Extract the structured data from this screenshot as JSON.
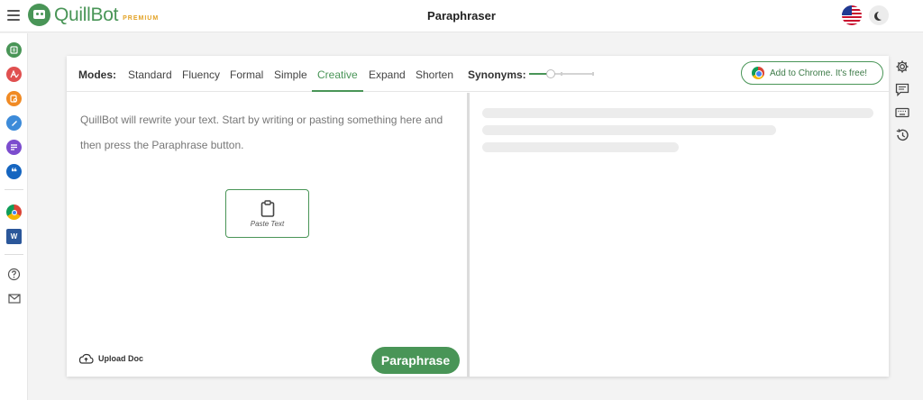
{
  "app": {
    "logo_text": "QuillBot",
    "logo_badge": "PREMIUM",
    "page_title": "Paraphraser",
    "brand_color": "#499557",
    "accent_badge_color": "#e3a224"
  },
  "header": {
    "menu_icon": "hamburger-menu-icon",
    "language_flag": "us-flag-icon",
    "theme_toggle_icon": "moon-icon"
  },
  "sidebar": {
    "items": [
      {
        "icon": "paraphraser-icon",
        "color": "#499557"
      },
      {
        "icon": "grammar-checker-icon",
        "color": "#e05050"
      },
      {
        "icon": "plagiarism-checker-icon",
        "color": "#f08a24"
      },
      {
        "icon": "co-writer-icon",
        "color": "#3d8bd9"
      },
      {
        "icon": "summarizer-icon",
        "color": "#7c4dce"
      },
      {
        "icon": "citation-generator-icon",
        "color": "#1565c0"
      },
      {
        "icon": "chrome-extension-icon",
        "color": "#db4437"
      },
      {
        "icon": "word-addin-icon",
        "color": "#2b579a"
      },
      {
        "icon": "help-icon",
        "color": "#555555"
      },
      {
        "icon": "mail-icon",
        "color": "#555555"
      }
    ]
  },
  "modes": {
    "label": "Modes:",
    "items": [
      "Standard",
      "Fluency",
      "Formal",
      "Simple",
      "Creative",
      "Expand",
      "Shorten"
    ],
    "active": "Creative"
  },
  "synonyms": {
    "label": "Synonyms:",
    "level": 0.33
  },
  "chrome_promo": {
    "label": "Add to Chrome. It's free!"
  },
  "editor": {
    "placeholder": "QuillBot will rewrite your text. Start by writing or pasting something here and then press the Paraphrase button.",
    "paste_label": "Paste Text",
    "paste_icon": "clipboard-icon",
    "upload_label": "Upload Doc",
    "upload_icon": "cloud-upload-icon",
    "paraphrase_label": "Paraphrase"
  },
  "tools": [
    {
      "icon": "settings-icon"
    },
    {
      "icon": "feedback-icon"
    },
    {
      "icon": "keyboard-icon"
    },
    {
      "icon": "history-icon"
    }
  ]
}
